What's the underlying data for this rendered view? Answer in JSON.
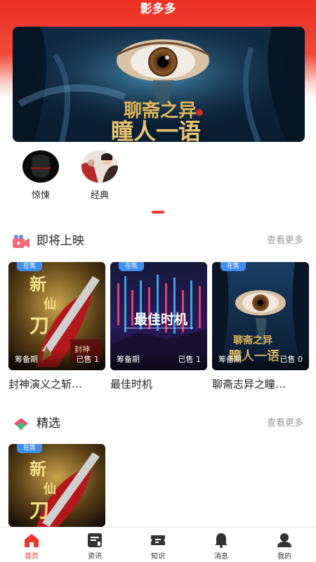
{
  "app": {
    "title": "影多多"
  },
  "colors": {
    "brand_red": "#ea2f25",
    "tag_blue": "#3f8ff0",
    "more_gray": "#999999"
  },
  "banner": {
    "title_art": "聊斋之异 瞳人一语",
    "indicator_active": 1,
    "indicator_total": 1
  },
  "categories": [
    {
      "label": "惊悚",
      "icon": "thriller-thumb"
    },
    {
      "label": "经典",
      "icon": "classic-thumb"
    }
  ],
  "upcoming": {
    "title": "即将上映",
    "more": "查看更多",
    "items": [
      {
        "title": "封神演义之斩…",
        "tag": "在售",
        "stage": "筹备期",
        "sold": "已售 1"
      },
      {
        "title": "最佳时机",
        "tag": "在售",
        "stage": "筹备期",
        "sold": "已售 1"
      },
      {
        "title": "聊斋志异之瞳…",
        "tag": "在售",
        "stage": "筹备期",
        "sold": "已售 0"
      }
    ]
  },
  "picks": {
    "title": "精选",
    "more": "查看更多",
    "items": [
      {
        "tag": "在售"
      }
    ]
  },
  "tabbar": [
    {
      "label": "首页",
      "icon": "home-icon",
      "active": true
    },
    {
      "label": "资讯",
      "icon": "news-icon",
      "active": false
    },
    {
      "label": "知识",
      "icon": "ticket-icon",
      "active": false
    },
    {
      "label": "消息",
      "icon": "bell-icon",
      "active": false
    },
    {
      "label": "我的",
      "icon": "profile-icon",
      "active": false
    }
  ]
}
